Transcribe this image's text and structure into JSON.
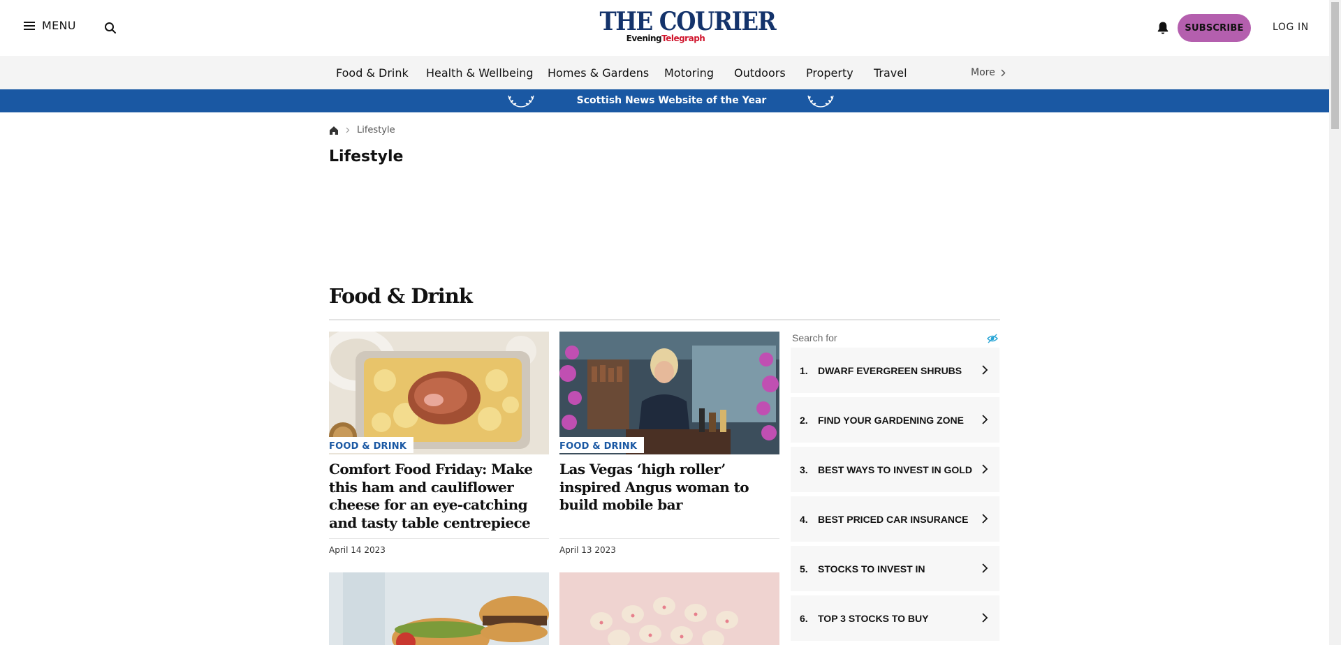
{
  "header": {
    "menu_label": "MENU",
    "logo_main": "THE COURIER",
    "logo_sub_1": "Evening",
    "logo_sub_2": "Telegraph",
    "subscribe_label": "SUBSCRIBE",
    "login_label": "LOG IN",
    "icons": [
      "menu-icon",
      "search-icon",
      "bell-icon"
    ]
  },
  "nav": {
    "items": [
      {
        "label": "Food & Drink"
      },
      {
        "label": "Health & Wellbeing"
      },
      {
        "label": "Homes & Gardens"
      },
      {
        "label": "Motoring"
      },
      {
        "label": "Outdoors"
      },
      {
        "label": "Property"
      },
      {
        "label": "Travel"
      }
    ],
    "more_label": "More"
  },
  "award": {
    "text": "Scottish News Website of the Year"
  },
  "breadcrumb": {
    "current": "Lifestyle"
  },
  "page": {
    "title": "Lifestyle"
  },
  "section": {
    "title": "Food & Drink"
  },
  "articles": [
    {
      "tag": "FOOD & DRINK",
      "headline": "Comfort Food Friday: Make this ham and cauliflower cheese for an eye-catching and tasty table centrepiece",
      "date": "April 14 2023"
    },
    {
      "tag": "FOOD & DRINK",
      "headline": "Las Vegas ‘high roller’ inspired Angus woman to build mobile bar",
      "date": "April 13 2023"
    }
  ],
  "ad": {
    "label": "Search for",
    "items": [
      {
        "num": "1.",
        "text": "DWARF EVERGREEN SHRUBS"
      },
      {
        "num": "2.",
        "text": "FIND YOUR GARDENING ZONE"
      },
      {
        "num": "3.",
        "text": "BEST WAYS TO INVEST IN GOLD"
      },
      {
        "num": "4.",
        "text": "BEST PRICED CAR INSURANCE"
      },
      {
        "num": "5.",
        "text": "STOCKS TO INVEST IN"
      },
      {
        "num": "6.",
        "text": "TOP 3 STOCKS TO BUY"
      }
    ]
  },
  "colors": {
    "brand_navy": "#14336b",
    "brand_red": "#d0142c",
    "award_blue": "#1a58a3",
    "subscribe_purple": "#b45fae",
    "tag_blue": "#1a58a3"
  }
}
